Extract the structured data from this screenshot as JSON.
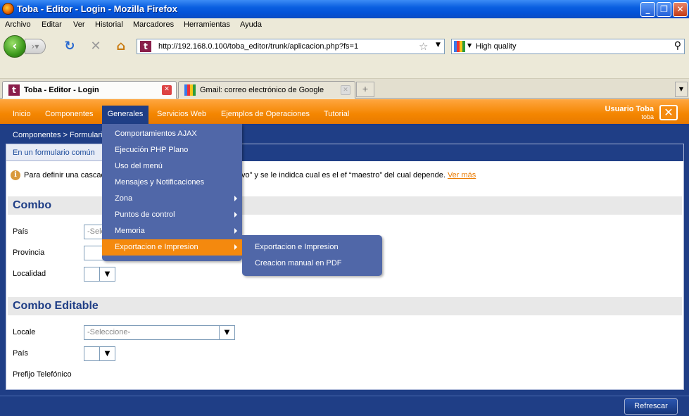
{
  "window": {
    "title": "Toba - Editor - Login - Mozilla Firefox"
  },
  "menubar": {
    "items": [
      "Archivo",
      "Editar",
      "Ver",
      "Historial",
      "Marcadores",
      "Herramientas",
      "Ayuda"
    ]
  },
  "navbar": {
    "url": "http://192.168.0.100/toba_editor/trunk/aplicacion.php?fs=1",
    "search_text": "High quality"
  },
  "tabs": [
    {
      "label": "Toba - Editor - Login",
      "active": true
    },
    {
      "label": "Gmail: correo electrónico de Google",
      "active": false
    }
  ],
  "app": {
    "nav": [
      "Inicio",
      "Componentes",
      "Generales",
      "Servicios Web",
      "Ejemplos de Operaciones",
      "Tutorial"
    ],
    "user_name": "Usuario Toba",
    "user_id": "toba",
    "breadcrumb": "Componentes > Formulario",
    "subtab": "En un formulario común",
    "info_left": "Para definir una cascada",
    "info_right": "clavo” y se le indidca cual es el ef “maestro” del cual depende.",
    "info_more": "Ver más",
    "section1": {
      "title": "Combo",
      "fields": [
        {
          "label": "País",
          "value": "-Seleccione-"
        },
        {
          "label": "Provincia",
          "value": ""
        },
        {
          "label": "Localidad",
          "value": ""
        }
      ]
    },
    "section2": {
      "title": "Combo Editable",
      "fields": [
        {
          "label": "Locale",
          "value": "-Seleccione-"
        },
        {
          "label": "País",
          "value": ""
        },
        {
          "label": "Prefijo Telefónico",
          "value": ""
        }
      ]
    },
    "refresh_label": "Refrescar",
    "generales_menu": [
      "Comportamientos AJAX",
      "Ejecución PHP Plano",
      "Uso del menú",
      "Mensajes y Notificaciones",
      "Zona",
      "Puntos de control",
      "Memoria",
      "Exportacion e Impresion"
    ],
    "export_submenu": [
      "Exportacion e Impresion",
      "Creacion manual en PDF"
    ]
  }
}
